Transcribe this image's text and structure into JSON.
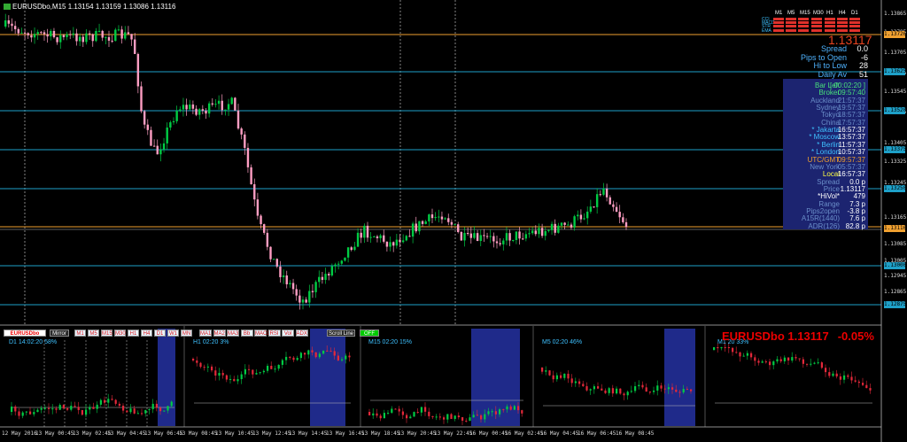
{
  "window": {
    "title": "EURUSDbo,M15  1.13154 1.13159 1.13086 1.13116"
  },
  "colors": {
    "background": "#000000",
    "bull": "#00cc44",
    "bear": "#ff9ec3",
    "hline": "#1ea0c8",
    "orange": "#f0a030",
    "panel": "#1c2470"
  },
  "price_axis": {
    "labels": [
      "1.13865",
      "1.13785",
      "1.13705",
      "1.13625",
      "1.13545",
      "1.13465",
      "1.13405",
      "1.13325",
      "1.13245",
      "1.13165",
      "1.13085",
      "1.13005",
      "1.12945",
      "1.12865"
    ]
  },
  "highlighted_levels": {
    "labels": [
      "1.13726",
      "1.13625",
      "1.13520",
      "1.13375",
      "1.13250",
      "1.13116",
      "1.13000",
      "1.12875"
    ]
  },
  "big_price": "1.13117",
  "stats": [
    {
      "label": "Spread",
      "value": "0.0"
    },
    {
      "label": "Pips to Open",
      "value": "-6"
    },
    {
      "label": "Hi to Low",
      "value": "28"
    },
    {
      "label": "Daily Av",
      "value": "51"
    }
  ],
  "timeframe_grid": {
    "headers": [
      "M1",
      "M5",
      "M15",
      "M30",
      "H1",
      "H4",
      "D1"
    ],
    "row_labels": [
      "CCI",
      "MACD",
      "STR",
      "EMA"
    ],
    "row_prefix": "CCI"
  },
  "info_panel": [
    {
      "label": "Bar Left",
      "value": "[ 00:02:20 ]",
      "lc": "#49e07a",
      "vc": "#49e07a"
    },
    {
      "label": "Broker",
      "value": "09:57:40",
      "lc": "#49e07a",
      "vc": "#49e07a"
    },
    {
      "label": "Auckland",
      "value": "21:57:37",
      "lc": "#6a8ec9",
      "vc": "#6a8ec9"
    },
    {
      "label": "Sydney",
      "value": "19:57:37",
      "lc": "#6a8ec9",
      "vc": "#6a8ec9"
    },
    {
      "label": "Tokyo",
      "value": "18:57:37",
      "lc": "#6a8ec9",
      "vc": "#6a8ec9"
    },
    {
      "label": "China",
      "value": "17:57:37",
      "lc": "#6a8ec9",
      "vc": "#6a8ec9"
    },
    {
      "label": "* Jakarta",
      "value": "16:57:37",
      "lc": "#3ec1ff",
      "vc": "#ffffff"
    },
    {
      "label": "* Moscow",
      "value": "13:57:37",
      "lc": "#3ec1ff",
      "vc": "#ffffff"
    },
    {
      "label": "* Berlin",
      "value": "11:57:37",
      "lc": "#3ec1ff",
      "vc": "#ffffff"
    },
    {
      "label": "* London",
      "value": "10:57:37",
      "lc": "#3ec1ff",
      "vc": "#ffffff"
    },
    {
      "label": "UTC/GMT",
      "value": "09:57:37",
      "lc": "#f0a030",
      "vc": "#f0a030"
    },
    {
      "label": "New York",
      "value": "05:57:37",
      "lc": "#6a8ec9",
      "vc": "#6a8ec9"
    },
    {
      "label": "Local",
      "value": "16:57:37",
      "lc": "#ffff40",
      "vc": "#ffffff"
    },
    {
      "label": "Spread",
      "value": "0.0 p",
      "lc": "#6a8ec9",
      "vc": "#ffffff"
    },
    {
      "label": "Price",
      "value": "1.13117",
      "lc": "#6a8ec9",
      "vc": "#ffffff"
    },
    {
      "label": "*HiVol*",
      "value": "479",
      "lc": "#ffffff",
      "vc": "#ffffff"
    },
    {
      "label": "Range",
      "value": "7.3 p",
      "lc": "#6a8ec9",
      "vc": "#ffffff"
    },
    {
      "label": "Pips2open",
      "value": "-3.8 p",
      "lc": "#6a8ec9",
      "vc": "#ffffff"
    },
    {
      "label": "A15R(1440)",
      "value": "7.6 p",
      "lc": "#6a8ec9",
      "vc": "#ffffff"
    },
    {
      "label": "ADR(126)",
      "value": "82.8 p",
      "lc": "#6a8ec9",
      "vc": "#ffffff"
    }
  ],
  "toolbar": {
    "symbol": "EURUSDbo",
    "mirror": "Mirror",
    "tfs": [
      "M1",
      "M5",
      "M15",
      "M30",
      "H1",
      "H4",
      "D1",
      "W1",
      "MN"
    ],
    "indicators": [
      "MA1",
      "MA2",
      "MA3",
      "Bb",
      "MACD",
      "RSI",
      "Vol",
      "ADX"
    ],
    "scroll": "Scroll Line",
    "off": "OFF"
  },
  "mini_panels": [
    {
      "label": "D1   14:02:20   58%"
    },
    {
      "label": "H1   02:20   3%"
    },
    {
      "label": "M15   02:20   15%"
    },
    {
      "label": "M5   02:20   46%"
    },
    {
      "label": "M1   20   33%"
    }
  ],
  "mini_title": {
    "symbol": "EURUSDbo",
    "price": "1.13117",
    "change": "-0.05%"
  },
  "time_axis": {
    "labels": [
      "12 May 2016",
      "13 May 00:45",
      "13 May 02:45",
      "13 May 04:45",
      "13 May 06:45",
      "13 May 08:45",
      "13 May 10:45",
      "13 May 12:45",
      "13 May 14:45",
      "13 May 16:45",
      "13 May 18:45",
      "13 May 20:45",
      "13 May 22:45",
      "16 May 00:45",
      "16 May 02:45",
      "16 May 04:45",
      "16 May 06:45",
      "16 May 08:45"
    ]
  }
}
